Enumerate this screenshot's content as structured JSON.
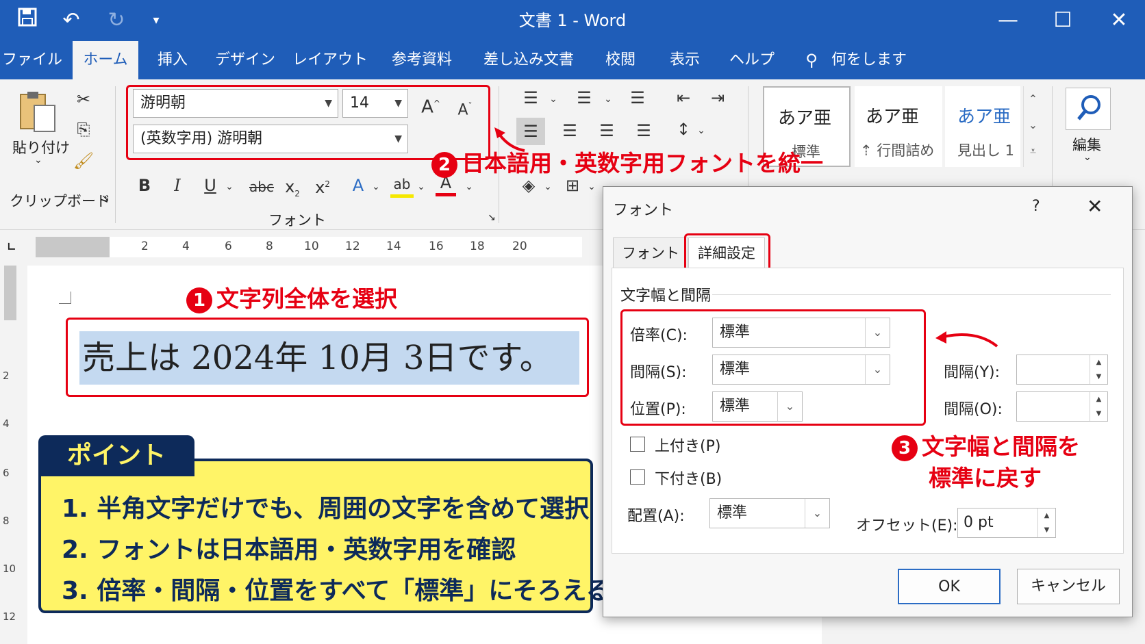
{
  "window": {
    "title": "文書 1  -  Word"
  },
  "tabs": [
    "ファイル",
    "ホーム",
    "挿入",
    "デザイン",
    "レイアウト",
    "参考資料",
    "差し込み文書",
    "校閲",
    "表示",
    "ヘルプ"
  ],
  "active_tab": "ホーム",
  "tell_me": "何をしますか",
  "clipboard": {
    "paste_label": "貼り付け",
    "group_label": "クリップボード"
  },
  "font_group": {
    "font_name": "游明朝",
    "font_size": "14",
    "ascii_font": "(英数字用) 游明朝",
    "group_label": "フォント"
  },
  "styles": [
    {
      "sample": "あア亜",
      "name": "標準"
    },
    {
      "sample": "あア亜",
      "name": "行間詰め"
    },
    {
      "sample": "あア亜",
      "name": "見出し 1"
    }
  ],
  "edit_label": "編集",
  "ruler": {
    "numbers": [
      "2",
      "4",
      "6",
      "8",
      "10",
      "12",
      "14",
      "16",
      "18",
      "20"
    ]
  },
  "vruler": {
    "numbers": [
      "2",
      "4",
      "6",
      "8",
      "10",
      "12"
    ]
  },
  "document": {
    "selected_text": "売上は 2024年 10月 3日です。"
  },
  "annotations": {
    "step1": "文字列全体を選択",
    "step2": "日本語用・英数字用フォントを統一",
    "step3_line1": "文字幅と間隔を",
    "step3_line2": "標準に戻す",
    "step1_num": "1",
    "step2_num": "2",
    "step3_num": "3"
  },
  "point": {
    "title": "ポイント",
    "lines": [
      "1. 半角文字だけでも、周囲の文字を含めて選択",
      "2. フォントは日本語用・英数字用を確認",
      "3. 倍率・間隔・位置をすべて「標準」にそろえる"
    ]
  },
  "dialog": {
    "title": "フォント",
    "help": "?",
    "tabs": [
      "フォント",
      "詳細設定"
    ],
    "active_tab": "詳細設定",
    "section": "文字幅と間隔",
    "scale_label": "倍率(C):",
    "scale_value": "標準",
    "spacing_label": "間隔(S):",
    "spacing_value": "標準",
    "position_label": "位置(P):",
    "position_value": "標準",
    "spacing_y_label": "間隔(Y):",
    "spacing_o_label": "間隔(O):",
    "superscript_label": "上付き(P)",
    "subscript_label": "下付き(B)",
    "align_label": "配置(A):",
    "align_value": "標準",
    "offset_label": "オフセット(E):",
    "offset_value": "0 pt",
    "ok": "OK",
    "cancel": "キャンセル"
  }
}
